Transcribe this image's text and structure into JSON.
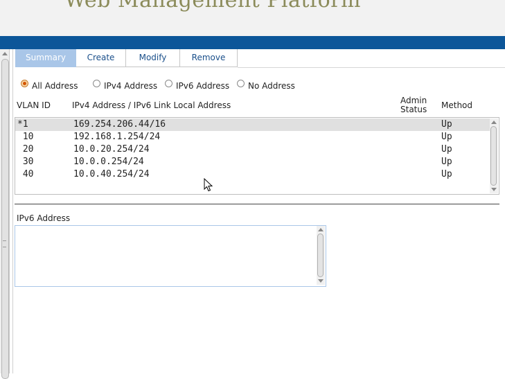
{
  "header": {
    "title": "Web Management Platform"
  },
  "tabs": [
    {
      "label": "Summary"
    },
    {
      "label": "Create"
    },
    {
      "label": "Modify"
    },
    {
      "label": "Remove"
    }
  ],
  "filter": {
    "options": [
      {
        "label": "All Address",
        "checked": true
      },
      {
        "label": "IPv4 Address",
        "checked": false
      },
      {
        "label": "IPv6 Address",
        "checked": false
      },
      {
        "label": "No Address",
        "checked": false
      }
    ]
  },
  "table": {
    "columns": {
      "vlan_id": "VLAN ID",
      "address": "IPv4 Address / IPv6 Link Local Address",
      "admin_status_line1": "Admin",
      "admin_status_line2": "Status",
      "method": "Method"
    },
    "rows": [
      {
        "vlan": "*1",
        "address": "169.254.206.44/16",
        "method": "Up",
        "selected": true
      },
      {
        "vlan": " 10",
        "address": "192.168.1.254/24",
        "method": "Up",
        "selected": false
      },
      {
        "vlan": " 20",
        "address": "10.0.20.254/24",
        "method": "Up",
        "selected": false
      },
      {
        "vlan": " 30",
        "address": "10.0.0.254/24",
        "method": "Up",
        "selected": false
      },
      {
        "vlan": " 40",
        "address": "10.0.40.254/24",
        "method": "Up",
        "selected": false
      }
    ]
  },
  "ipv6": {
    "label": "IPv6 Address",
    "value": ""
  },
  "colors": {
    "header_bar": "#0c5699",
    "active_tab": "#a9c6e8",
    "title": "#8b8b5a",
    "selected_row": "#e0e0e0"
  }
}
